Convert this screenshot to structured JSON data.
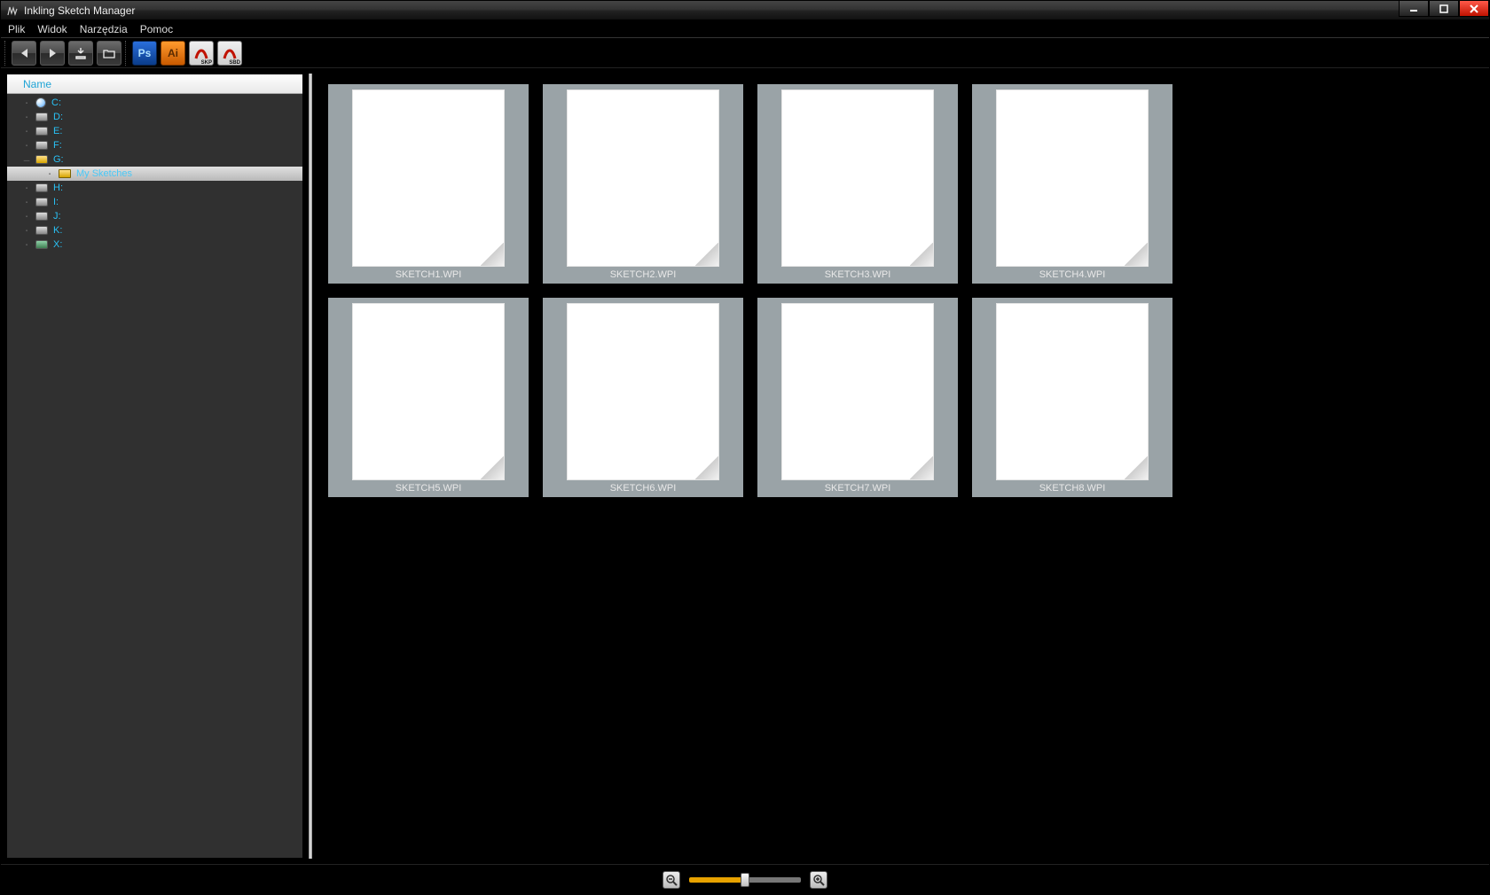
{
  "window": {
    "title": "Inkling Sketch Manager"
  },
  "menubar": [
    "Plik",
    "Widok",
    "Narzędzia",
    "Pomoc"
  ],
  "toolbar": {
    "back": "Back",
    "forward": "Forward",
    "import": "Import",
    "open_folder": "Open Folder",
    "ps": "Ps",
    "ai": "Ai",
    "skp": "SKP",
    "sbd": "SBD"
  },
  "sidebar": {
    "header": "Name",
    "drives": [
      {
        "label": "C:",
        "type": "c"
      },
      {
        "label": "D:",
        "type": "d"
      },
      {
        "label": "E:",
        "type": "d"
      },
      {
        "label": "F:",
        "type": "d"
      },
      {
        "label": "G:",
        "type": "g",
        "expanded": true,
        "children": [
          {
            "label": "My Sketches",
            "selected": true
          }
        ]
      },
      {
        "label": "H:",
        "type": "d"
      },
      {
        "label": "I:",
        "type": "d"
      },
      {
        "label": "J:",
        "type": "d"
      },
      {
        "label": "K:",
        "type": "d"
      },
      {
        "label": "X:",
        "type": "x"
      }
    ]
  },
  "thumbnails": [
    "SKETCH1.WPI",
    "SKETCH2.WPI",
    "SKETCH3.WPI",
    "SKETCH4.WPI",
    "SKETCH5.WPI",
    "SKETCH6.WPI",
    "SKETCH7.WPI",
    "SKETCH8.WPI"
  ],
  "zoom": {
    "value": 48,
    "min": 0,
    "max": 100
  }
}
